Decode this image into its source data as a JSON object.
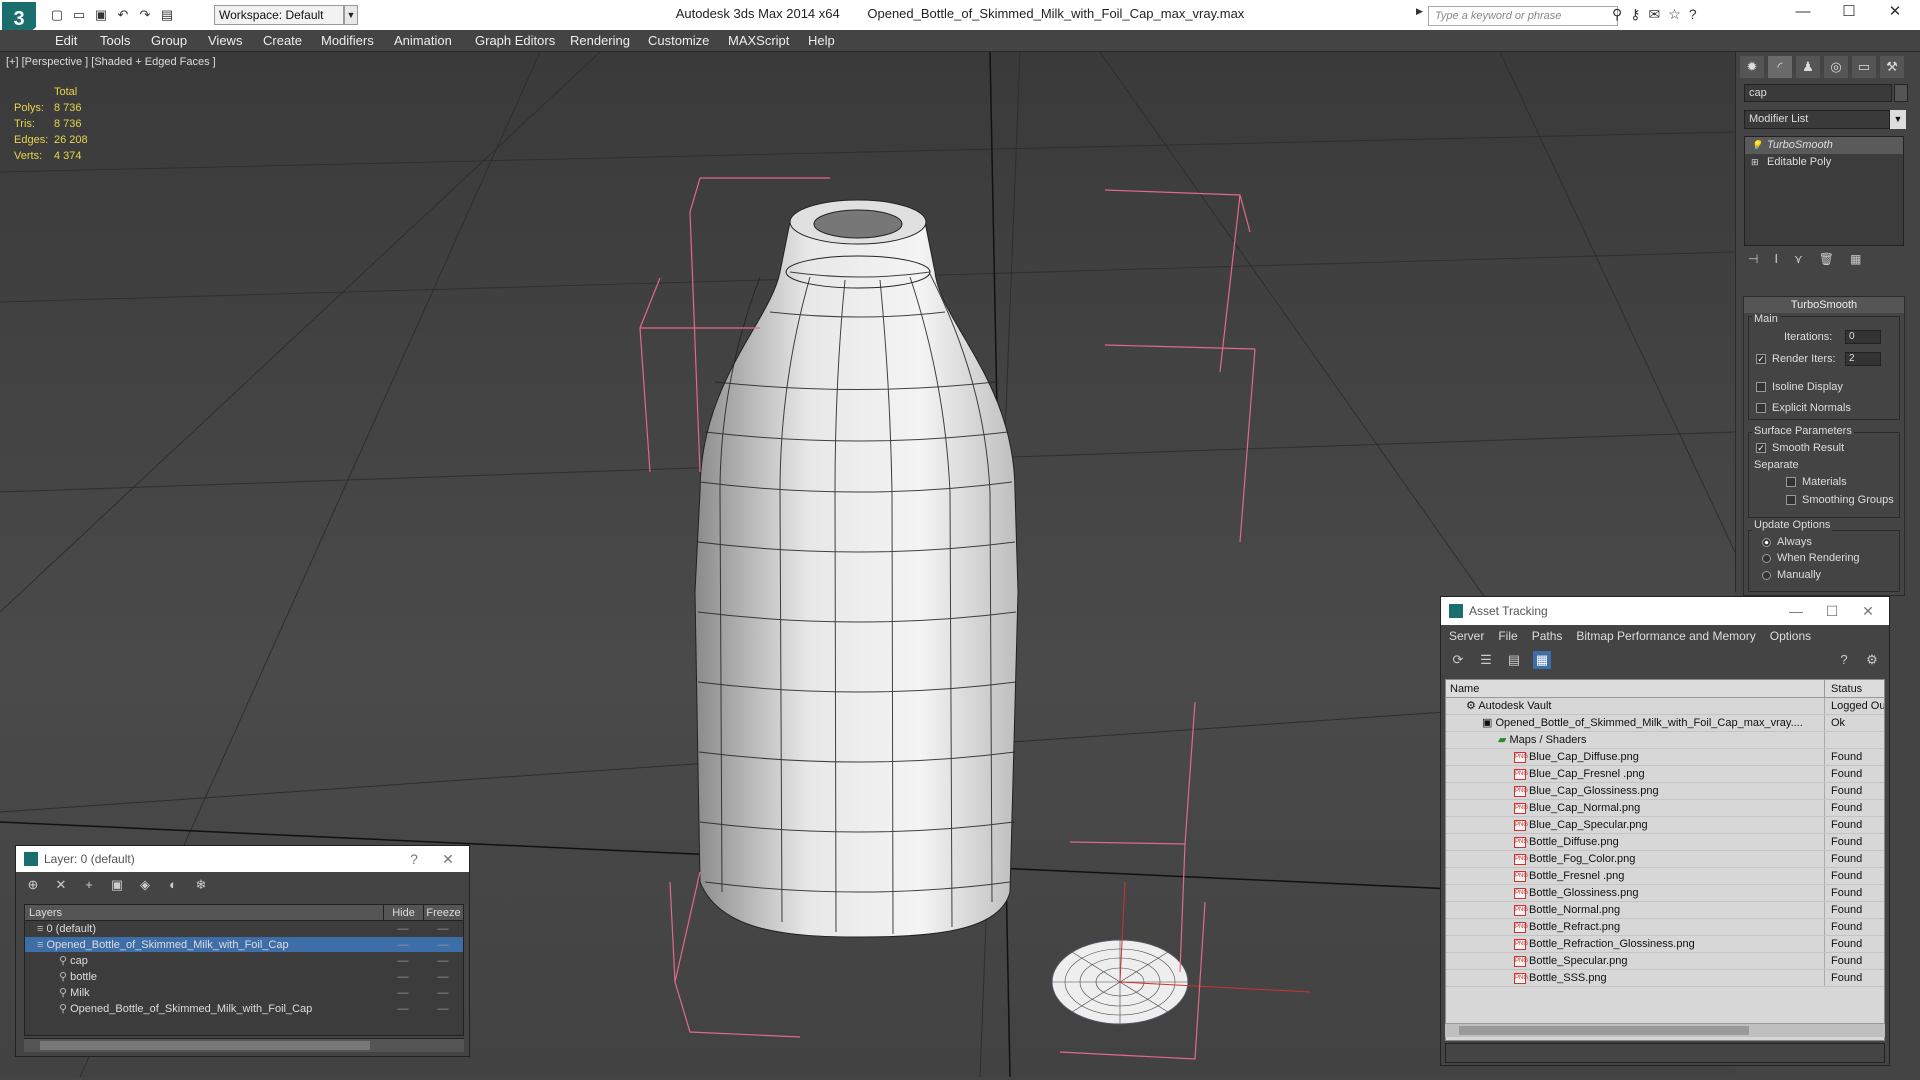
{
  "app": {
    "product": "Autodesk 3ds Max 2014 x64",
    "file": "Opened_Bottle_of_Skimmed_Milk_with_Foil_Cap_max_vray.max",
    "logo": "3",
    "workspace": "Workspace: Default",
    "search_placeholder": "Type a keyword or phrase"
  },
  "menu": [
    "Edit",
    "Tools",
    "Group",
    "Views",
    "Create",
    "Modifiers",
    "Animation",
    "Graph Editors",
    "Rendering",
    "Customize",
    "MAXScript",
    "Help"
  ],
  "viewport": {
    "label": "[+] [Perspective ] [Shaded + Edged Faces ]",
    "stats": {
      "header": "Total",
      "rows": [
        {
          "k": "Polys:",
          "v": "8 736"
        },
        {
          "k": "Tris:",
          "v": "8 736"
        },
        {
          "k": "Edges:",
          "v": "26 208"
        },
        {
          "k": "Verts:",
          "v": "4 374"
        }
      ]
    }
  },
  "command_panel": {
    "object_name": "cap",
    "modifier_list": "Modifier List",
    "stack": [
      "TurboSmooth",
      "Editable Poly"
    ],
    "rollout_title": "TurboSmooth",
    "main_label": "Main",
    "iterations_label": "Iterations:",
    "iterations_value": "0",
    "render_iters_label": "Render Iters:",
    "render_iters_value": "2",
    "isoline": "Isoline Display",
    "explicit_normals": "Explicit Normals",
    "surface_params": "Surface Parameters",
    "smooth_result": "Smooth Result",
    "separate": "Separate",
    "materials": "Materials",
    "smoothing_groups": "Smoothing Groups",
    "update_options": "Update Options",
    "always": "Always",
    "when_rendering": "When Rendering",
    "manually": "Manually"
  },
  "asset_tracking": {
    "title": "Asset Tracking",
    "menu": [
      "Server",
      "File",
      "Paths",
      "Bitmap Performance and Memory",
      "Options"
    ],
    "col_name": "Name",
    "col_status": "Status",
    "vault": {
      "name": "Autodesk Vault",
      "status": "Logged Ou"
    },
    "file": {
      "name": "Opened_Bottle_of_Skimmed_Milk_with_Foil_Cap_max_vray....",
      "status": "Ok"
    },
    "maps_label": "Maps / Shaders",
    "maps": [
      {
        "name": "Blue_Cap_Diffuse.png",
        "status": "Found"
      },
      {
        "name": "Blue_Cap_Fresnel .png",
        "status": "Found"
      },
      {
        "name": "Blue_Cap_Glossiness.png",
        "status": "Found"
      },
      {
        "name": "Blue_Cap_Normal.png",
        "status": "Found"
      },
      {
        "name": "Blue_Cap_Specular.png",
        "status": "Found"
      },
      {
        "name": "Bottle_Diffuse.png",
        "status": "Found"
      },
      {
        "name": "Bottle_Fog_Color.png",
        "status": "Found"
      },
      {
        "name": "Bottle_Fresnel .png",
        "status": "Found"
      },
      {
        "name": "Bottle_Glossiness.png",
        "status": "Found"
      },
      {
        "name": "Bottle_Normal.png",
        "status": "Found"
      },
      {
        "name": "Bottle_Refract.png",
        "status": "Found"
      },
      {
        "name": "Bottle_Refraction_Glossiness.png",
        "status": "Found"
      },
      {
        "name": "Bottle_Specular.png",
        "status": "Found"
      },
      {
        "name": "Bottle_SSS.png",
        "status": "Found"
      }
    ]
  },
  "layers": {
    "title": "Layer: 0 (default)",
    "help": "?",
    "col_layers": "Layers",
    "col_hide": "Hide",
    "col_freeze": "Freeze",
    "rows": [
      {
        "name": "0 (default)",
        "indent": 1
      },
      {
        "name": "Opened_Bottle_of_Skimmed_Milk_with_Foil_Cap",
        "indent": 1
      },
      {
        "name": "cap",
        "indent": 2
      },
      {
        "name": "bottle",
        "indent": 2
      },
      {
        "name": "Milk",
        "indent": 2
      },
      {
        "name": "Opened_Bottle_of_Skimmed_Milk_with_Foil_Cap",
        "indent": 2
      }
    ]
  }
}
